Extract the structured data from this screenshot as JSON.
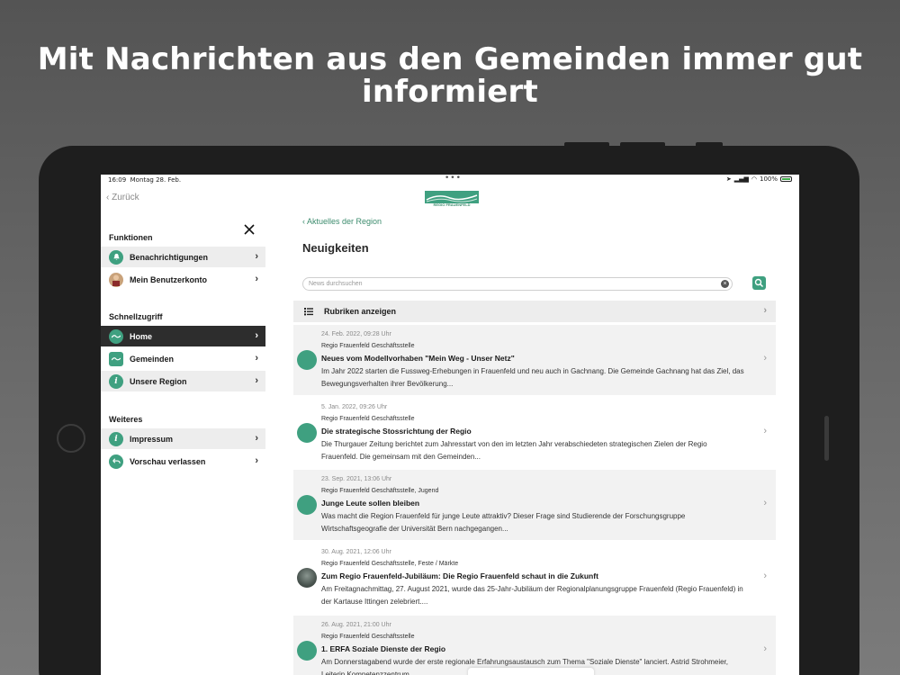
{
  "headline": "Mit Nachrichten aus den Gemeinden immer gut informiert",
  "status": {
    "time": "16:09",
    "date": "Montag 28. Feb.",
    "battery": "100%"
  },
  "logo_text": "REGIO FRAUENFELD",
  "back_label": "Zurück",
  "sidebar": {
    "sections": [
      {
        "title": "Funktionen",
        "items": [
          {
            "label": "Benachrichtigungen",
            "icon": "bell-icon"
          },
          {
            "label": "Mein Benutzerkonto",
            "icon": "user-avatar"
          }
        ]
      },
      {
        "title": "Schnellzugriff",
        "items": [
          {
            "label": "Home",
            "icon": "regio-logo-icon",
            "active": true
          },
          {
            "label": "Gemeinden",
            "icon": "map-icon"
          },
          {
            "label": "Unsere Region",
            "icon": "info-icon"
          }
        ]
      },
      {
        "title": "Weiteres",
        "items": [
          {
            "label": "Impressum",
            "icon": "info-icon"
          },
          {
            "label": "Vorschau verlassen",
            "icon": "undo-icon"
          }
        ]
      }
    ]
  },
  "main": {
    "breadcrumb": "Aktuelles der Region",
    "title": "Neuigkeiten",
    "search_placeholder": "News durchsuchen",
    "rubriken_label": "Rubriken anzeigen",
    "news": [
      {
        "date": "24. Feb. 2022, 09:28 Uhr",
        "source": "Regio Frauenfeld Geschäftsstelle",
        "title": "Neues vom Modellvorhaben \"Mein Weg - Unser Netz\"",
        "body": "Im Jahr 2022 starten die Fussweg-Erhebungen in Frauenfeld und neu auch in Gachnang. Die Gemeinde Gachnang hat das Ziel, das Bewegungsverhalten ihrer Bevölkerung..."
      },
      {
        "date": "5. Jan. 2022, 09:26 Uhr",
        "source": "Regio Frauenfeld Geschäftsstelle",
        "title": "Die strategische Stossrichtung der Regio",
        "body": "Die Thurgauer Zeitung berichtet zum Jahresstart von den im letzten Jahr verabschiedeten strategischen Zielen der Regio Frauenfeld. Die gemeinsam mit den Gemeinden..."
      },
      {
        "date": "23. Sep. 2021, 13:06 Uhr",
        "source": "Regio Frauenfeld Geschäftsstelle, Jugend",
        "title": "Junge Leute sollen bleiben",
        "body": "Was macht die Region Frauenfeld für junge Leute attraktiv? Dieser Frage sind Studierende der Forschungsgruppe Wirtschaftsgeografie der Universität Bern nachgegangen..."
      },
      {
        "date": "30. Aug. 2021, 12:06 Uhr",
        "source": "Regio Frauenfeld Geschäftsstelle, Feste / Märkte",
        "title": "Zum Regio Frauenfeld-Jubiläum: Die Regio Frauenfeld schaut in die Zukunft",
        "body": "Am Freitagnachmittag, 27. August 2021, wurde das 25-Jahr-Jubiläum der Regionalplanungsgruppe Frauenfeld (Regio Frauenfeld) in der Kartause Ittingen zelebriert...."
      },
      {
        "date": "26. Aug. 2021, 21:00 Uhr",
        "source": "Regio Frauenfeld Geschäftsstelle",
        "title": "1. ERFA Soziale Dienste der Regio",
        "body": "Am Donnerstagabend wurde der erste regionale Erfahrungsaustausch zum Thema \"Soziale Dienste\" lanciert. Astrid Strohmeier, Leiterin Kompetenzzentrum..."
      }
    ]
  },
  "colors": {
    "accent": "#3fa080",
    "active_bg": "#2d2d2d"
  }
}
